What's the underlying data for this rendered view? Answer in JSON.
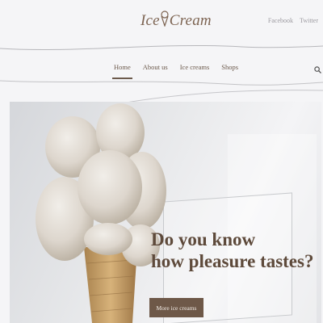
{
  "brand": {
    "logo_left": "Ice",
    "logo_right": "Cream"
  },
  "social": {
    "facebook": "Facebook",
    "twitter": "Twitter"
  },
  "nav": {
    "items": [
      {
        "label": "Home",
        "active": true
      },
      {
        "label": "About us",
        "active": false
      },
      {
        "label": "Ice creams",
        "active": false
      },
      {
        "label": "Shops",
        "active": false
      }
    ],
    "search_icon": "search-icon"
  },
  "hero": {
    "heading_line1": "Do you know",
    "heading_line2": "how pleasure tastes?",
    "cta_label": "More ice creams"
  },
  "colors": {
    "brand_brown": "#6e5848",
    "text_brown": "#5e4a3b",
    "background": "#f5f5f7"
  }
}
